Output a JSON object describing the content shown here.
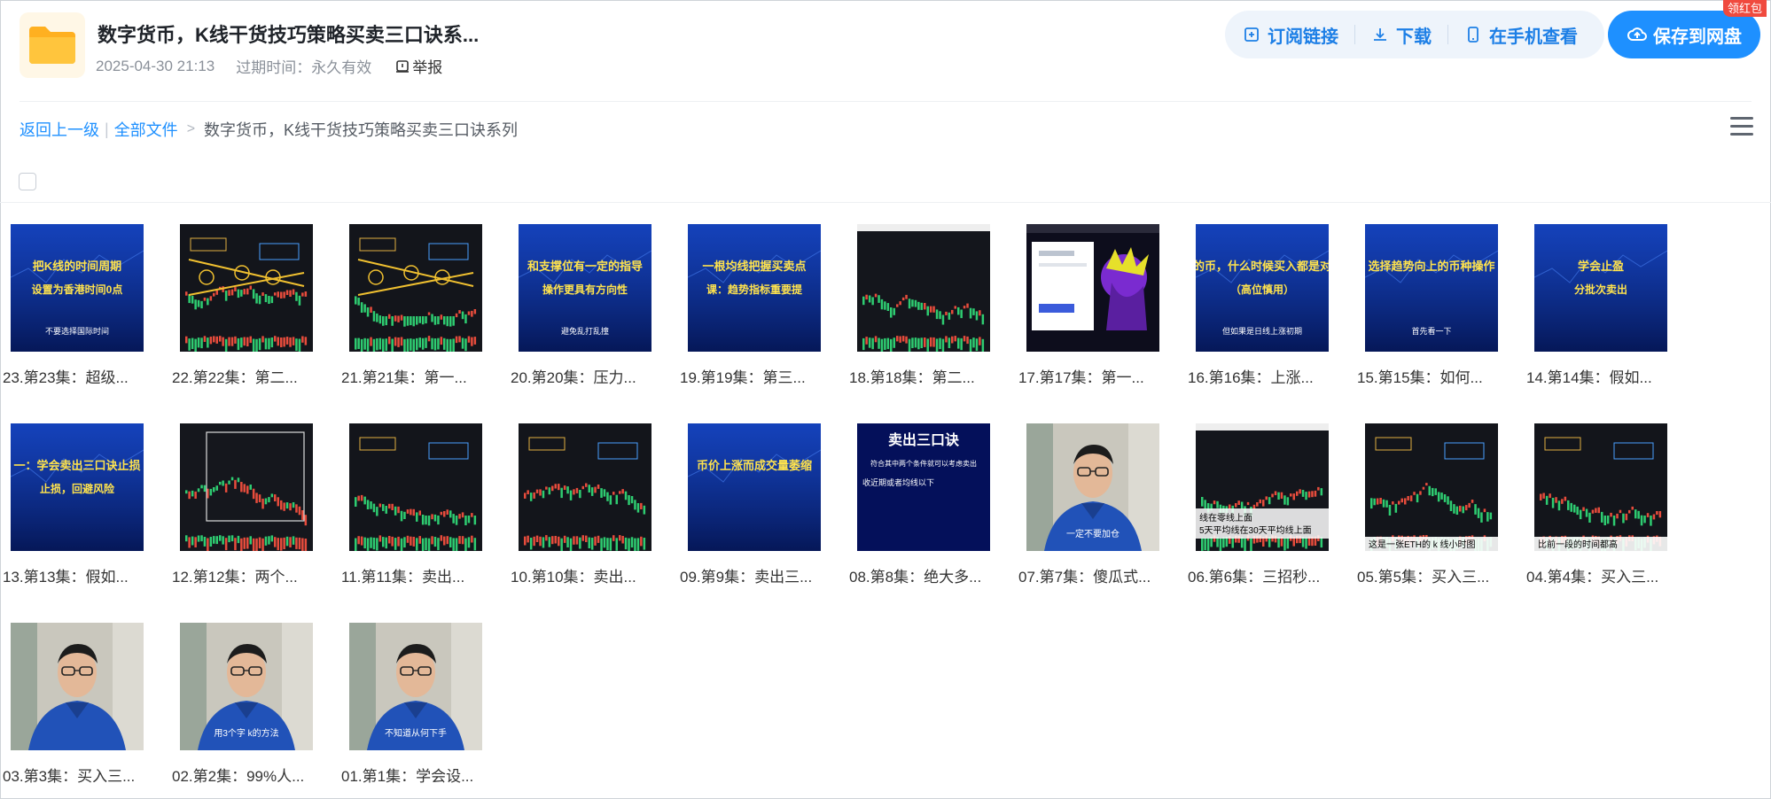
{
  "header": {
    "title": "数字货币，K线干货技巧策略买卖三口诀系...",
    "date": "2025-04-30 21:13",
    "expire": "过期时间：永久有效",
    "report": "举报",
    "actions": {
      "subscribe": "订阅链接",
      "download": "下载",
      "mobile": "在手机查看",
      "save": "保存到网盘"
    },
    "badge": "领红包"
  },
  "breadcrumb": {
    "back": "返回上一级",
    "all": "全部文件",
    "current": "数字货币，K线干货技巧策略买卖三口诀系列"
  },
  "colors": {
    "accent": "#1e90ff",
    "badge": "#f04a3e",
    "folder": "#ffc53d"
  },
  "files": [
    {
      "name": "23.第23集：超级...",
      "thumb": "blue",
      "text": [
        "把K线的时间周期",
        "设置为香港时间0点",
        "不要选择国际时间"
      ]
    },
    {
      "name": "22.第22集：第二...",
      "thumb": "dark-circles"
    },
    {
      "name": "21.第21集：第一...",
      "thumb": "dark-green-circles"
    },
    {
      "name": "20.第20集：压力...",
      "thumb": "blue",
      "text": [
        "和支撑位有一定的指导",
        "操作更具有方向性",
        "避免乱打乱撞"
      ]
    },
    {
      "name": "19.第19集：第三...",
      "thumb": "blue",
      "text": [
        "一根均线把握买卖点",
        "课：趋势指标重要提",
        ""
      ]
    },
    {
      "name": "18.第18集：第二...",
      "thumb": "dark-chart"
    },
    {
      "name": "17.第17集：第一...",
      "thumb": "app"
    },
    {
      "name": "16.第16集：上涨...",
      "thumb": "blue",
      "text": [
        "货的币，什么时候买入都是对的",
        "（高位慎用）",
        "但如果是日线上涨初期"
      ]
    },
    {
      "name": "15.第15集：如何...",
      "thumb": "blue",
      "text": [
        "选择趋势向上的币种操作",
        "",
        "首先看一下"
      ]
    },
    {
      "name": "14.第14集：假如...",
      "thumb": "blue",
      "text": [
        "学会止盈",
        "分批次卖出",
        ""
      ]
    },
    {
      "name": "13.第13集：假如...",
      "thumb": "blue",
      "text": [
        "一：学会卖出三口诀止损",
        "止损，回避风险",
        ""
      ]
    },
    {
      "name": "12.第12集：两个...",
      "thumb": "dark-box"
    },
    {
      "name": "11.第11集：卖出...",
      "thumb": "dark-annot"
    },
    {
      "name": "10.第10集：卖出...",
      "thumb": "dark-annot"
    },
    {
      "name": "09.第9集：卖出三...",
      "thumb": "blue",
      "text": [
        "币价上涨而成交量萎缩",
        "",
        ""
      ]
    },
    {
      "name": "08.第8集：绝大多...",
      "thumb": "navy",
      "text": [
        "卖出三口诀",
        "符合其中两个条件就可以考虑卖出",
        "收近期或者均线以下"
      ]
    },
    {
      "name": "07.第7集：傻瓜式...",
      "thumb": "person",
      "text": [
        "一定不要加仓"
      ]
    },
    {
      "name": "06.第6集：三招秒...",
      "thumb": "dark-chart2",
      "text": [
        "线在零线上面",
        "5天平均线在30天平均线上面"
      ]
    },
    {
      "name": "05.第5集：买入三...",
      "thumb": "dark-annot",
      "text": [
        "这是一张ETH的 k 线小时图"
      ]
    },
    {
      "name": "04.第4集：买入三...",
      "thumb": "dark-annot",
      "text": [
        "比前一段的时间都高"
      ]
    },
    {
      "name": "03.第3集：买入三...",
      "thumb": "person",
      "text": [
        ""
      ]
    },
    {
      "name": "02.第2集：99%人...",
      "thumb": "person",
      "text": [
        "用3个字 k的方法"
      ]
    },
    {
      "name": "01.第1集：学会设...",
      "thumb": "person",
      "text": [
        "不知道从何下手"
      ]
    }
  ]
}
